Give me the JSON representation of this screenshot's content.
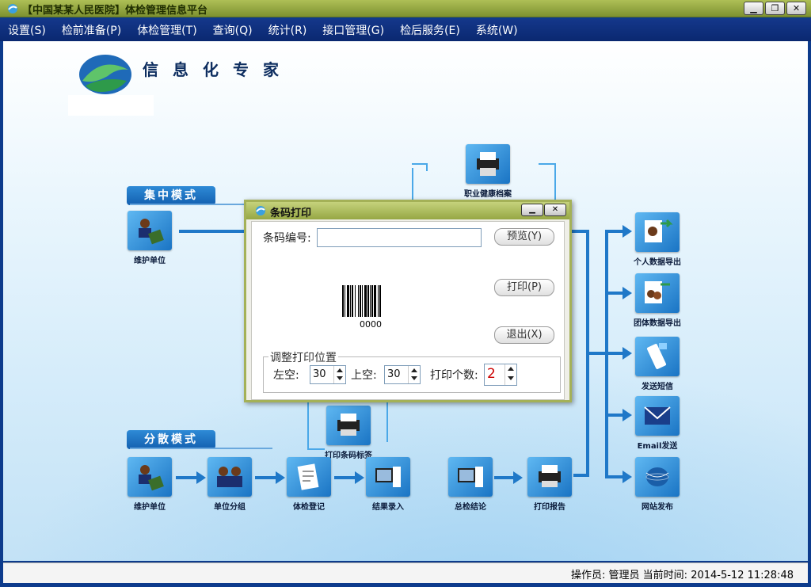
{
  "window": {
    "title": "【中国某某人民医院】体检管理信息平台",
    "buttons": [
      "▁",
      "❐",
      "✕"
    ]
  },
  "menu": [
    "设置(S)",
    "检前准备(P)",
    "体检管理(T)",
    "查询(Q)",
    "统计(R)",
    "接口管理(G)",
    "检后服务(E)",
    "系统(W)"
  ],
  "banner": {
    "slogan": "信息化专家"
  },
  "modes": {
    "centralized": "集中模式",
    "distributed": "分散模式"
  },
  "nodes": {
    "occupational_archive": "职业健康档案",
    "maintain_unit_top": "维护单位",
    "maintain_unit_bottom": "维护单位",
    "unit_group": "单位分组",
    "exam_register": "体检登记",
    "result_entry": "结果录入",
    "summary": "总检结论",
    "print_report": "打印报告",
    "print_barcode_label": "打印条码标签",
    "personal_export": "个人数据导出",
    "group_export": "团体数据导出",
    "send_sms": "发送短信",
    "email_send": "Email发送",
    "website_publish": "网站发布"
  },
  "dialog": {
    "title": "条码打印",
    "barcode_label": "条码编号:",
    "barcode_value": "",
    "preview_button": "预览(Y)",
    "print_button": "打印(P)",
    "exit_button": "退出(X)",
    "barcode_number": "0000",
    "group_title": "调整打印位置",
    "left_label": "左空:",
    "left_value": "30",
    "top_label": "上空:",
    "top_value": "30",
    "count_label": "打印个数:",
    "count_value": "2",
    "title_buttons": [
      "▁",
      "✕"
    ]
  },
  "status": {
    "text": "操作员: 管理员  当前时间: 2014-5-12 11:28:48"
  },
  "colors": {
    "accent": "#1f78c8",
    "title_bar": "#96a744",
    "menu_bar": "#0a2870"
  }
}
